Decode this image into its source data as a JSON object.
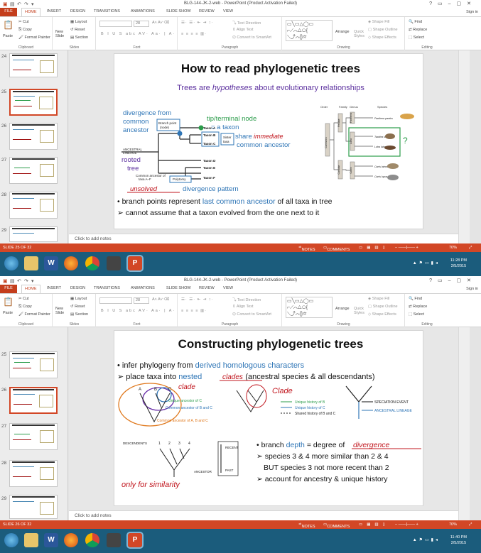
{
  "windows": [
    {
      "window_title": "BLG-144-JK-2-web - PowerPoint (Product Activation Failed)",
      "slide_title": "How to read phylogenetic trees",
      "subtitle_pre": "Trees are ",
      "subtitle_em": "hypotheses",
      "subtitle_post": " about evolutionary relationships",
      "labels": {
        "divergence_from": "divergence from",
        "common": "common",
        "ancestor": "ancestor",
        "branch_point": "Branch point",
        "node": "(node)",
        "tip_node": "tip/terminal node",
        "eq_taxon": "= a taxon",
        "share": "share",
        "common_ancestor": "common ancestor",
        "ancestral": "ANCESTRAL",
        "lineage": "LINEAGE",
        "rooted": "rooted",
        "tree": "tree",
        "ca_af_1": "Common ancestor of",
        "ca_af_2": "taxa A–F",
        "polytomy": "Polytomy",
        "divergence_pattern": "divergence pattern",
        "taxa": [
          "Taxon A",
          "Taxon B",
          "Taxon C",
          "Taxon D",
          "Taxon E",
          "Taxon F"
        ],
        "sister_taxa_1": "Sister",
        "sister_taxa_2": "taxa",
        "hw_immediate": "immediate",
        "hw_unsolved": "unsolved",
        "order_hdr": "Order",
        "family_hdr": "Family",
        "genus_hdr": "Genus",
        "species_hdr": "Species",
        "order": "Carnivora",
        "family_1": "Felidae",
        "family_2": "Canidae",
        "genus_1": "Panthera",
        "genus_2": "Lutra",
        "genus_3": "Canis",
        "species_1": "Panthera pardus",
        "species_2": "Taxidea taxus",
        "species_3": "Lutra lutra",
        "species_4": "Canis latrans",
        "species_5": "Canis lupus",
        "question": "?"
      },
      "bullet_1_pre": "• branch points represent ",
      "bullet_1_em": "last common ancestor",
      "bullet_1_post": " of all taxa in tree",
      "bullet_2": "➢ cannot assume that a taxon evolved from the one next to it",
      "slide_status": "SLIDE 25 OF 32",
      "zoom": "70%",
      "time": "11:28 PM",
      "date": "2/5/2015",
      "active_slide": 25
    },
    {
      "window_title": "BLG-144-JK-2-web - PowerPoint (Product Activation Failed)",
      "slide_title": "Constructing phylogenetic trees",
      "b1_pre": "• infer phylogeny from ",
      "b1_em": "derived homologous characters",
      "b2_pre": "➢ place taxa into ",
      "b2_em": "nested",
      "b2_post": " (ancestral species & all descendants)",
      "labels": {
        "hw_clade": "clades",
        "hw_clade2": "clade",
        "hw_clade3": "Clade",
        "A": "A",
        "B": "B",
        "C": "C",
        "ua_c": "Unique ancestor of C",
        "ca_bc": "Common ancestor of B and C",
        "ca_abc": "Common ancestor of A, B and C",
        "uh_b": "Unique history of B",
        "uh_c": "Unique history of C",
        "sh_bc": "Shared history of B and C",
        "speciation": "SPECIATION EVENT",
        "anc_lineage": "ANCESTRAL LINEAGE",
        "descendents": "DESCENDENTS",
        "n1": "1",
        "n2": "2",
        "n3": "3",
        "n4": "4",
        "ancestor": "ANCESTOR",
        "recent": "RECENT",
        "past": "PAST",
        "hw_similarity": "only for similarity",
        "hw_divergence": "divergence"
      },
      "b3_pre": "• branch ",
      "b3_em": "depth",
      "b3_post": " = degree of ",
      "b4": "➢ species 3 & 4 more similar than 2 & 4",
      "b5": "BUT species 3 not more recent than 2",
      "b6": "➢ account for ancestry & unique history",
      "slide_status": "SLIDE 26 OF 32",
      "zoom": "70%",
      "time": "11:40 PM",
      "date": "2/5/2015",
      "active_slide": 26
    }
  ],
  "tabs": [
    "FILE",
    "HOME",
    "INSERT",
    "DESIGN",
    "TRANSITIONS",
    "ANIMATIONS",
    "SLIDE SHOW",
    "REVIEW",
    "VIEW"
  ],
  "sign_in": "Sign in",
  "ribbon": {
    "clipboard": "Clipboard",
    "slides": "Slides",
    "font": "Font",
    "paragraph": "Paragraph",
    "drawing": "Drawing",
    "editing": "Editing",
    "paste": "Paste",
    "cut": "Cut",
    "copy": "Copy",
    "format_painter": "Format Painter",
    "new_slide": "New",
    "new_slide_2": "Slide",
    "layout": "Layout",
    "reset": "Reset",
    "section": "Section",
    "font_size": "28",
    "text_direction": "Text Direction",
    "align_text": "Align Text",
    "convert_smartart": "Convert to SmartArt",
    "arrange": "Arrange",
    "quick_styles": "Quick",
    "quick_styles_2": "Styles",
    "shape_fill": "Shape Fill",
    "shape_outline": "Shape Outline",
    "shape_effects": "Shape Effects",
    "find": "Find",
    "replace": "Replace",
    "select": "Select"
  },
  "thumb_numbers": [
    "24",
    "25",
    "26",
    "27",
    "28",
    "29"
  ],
  "click_to_add_notes": "Click to add notes",
  "status_notes": "NOTES",
  "status_comments": "COMMENTS",
  "colors": {
    "accent": "#d24726",
    "blue_text": "#2e75b6",
    "green_text": "#2b9c4a",
    "ink_red": "#c0141c",
    "taskbar": "#1b5c7c"
  }
}
